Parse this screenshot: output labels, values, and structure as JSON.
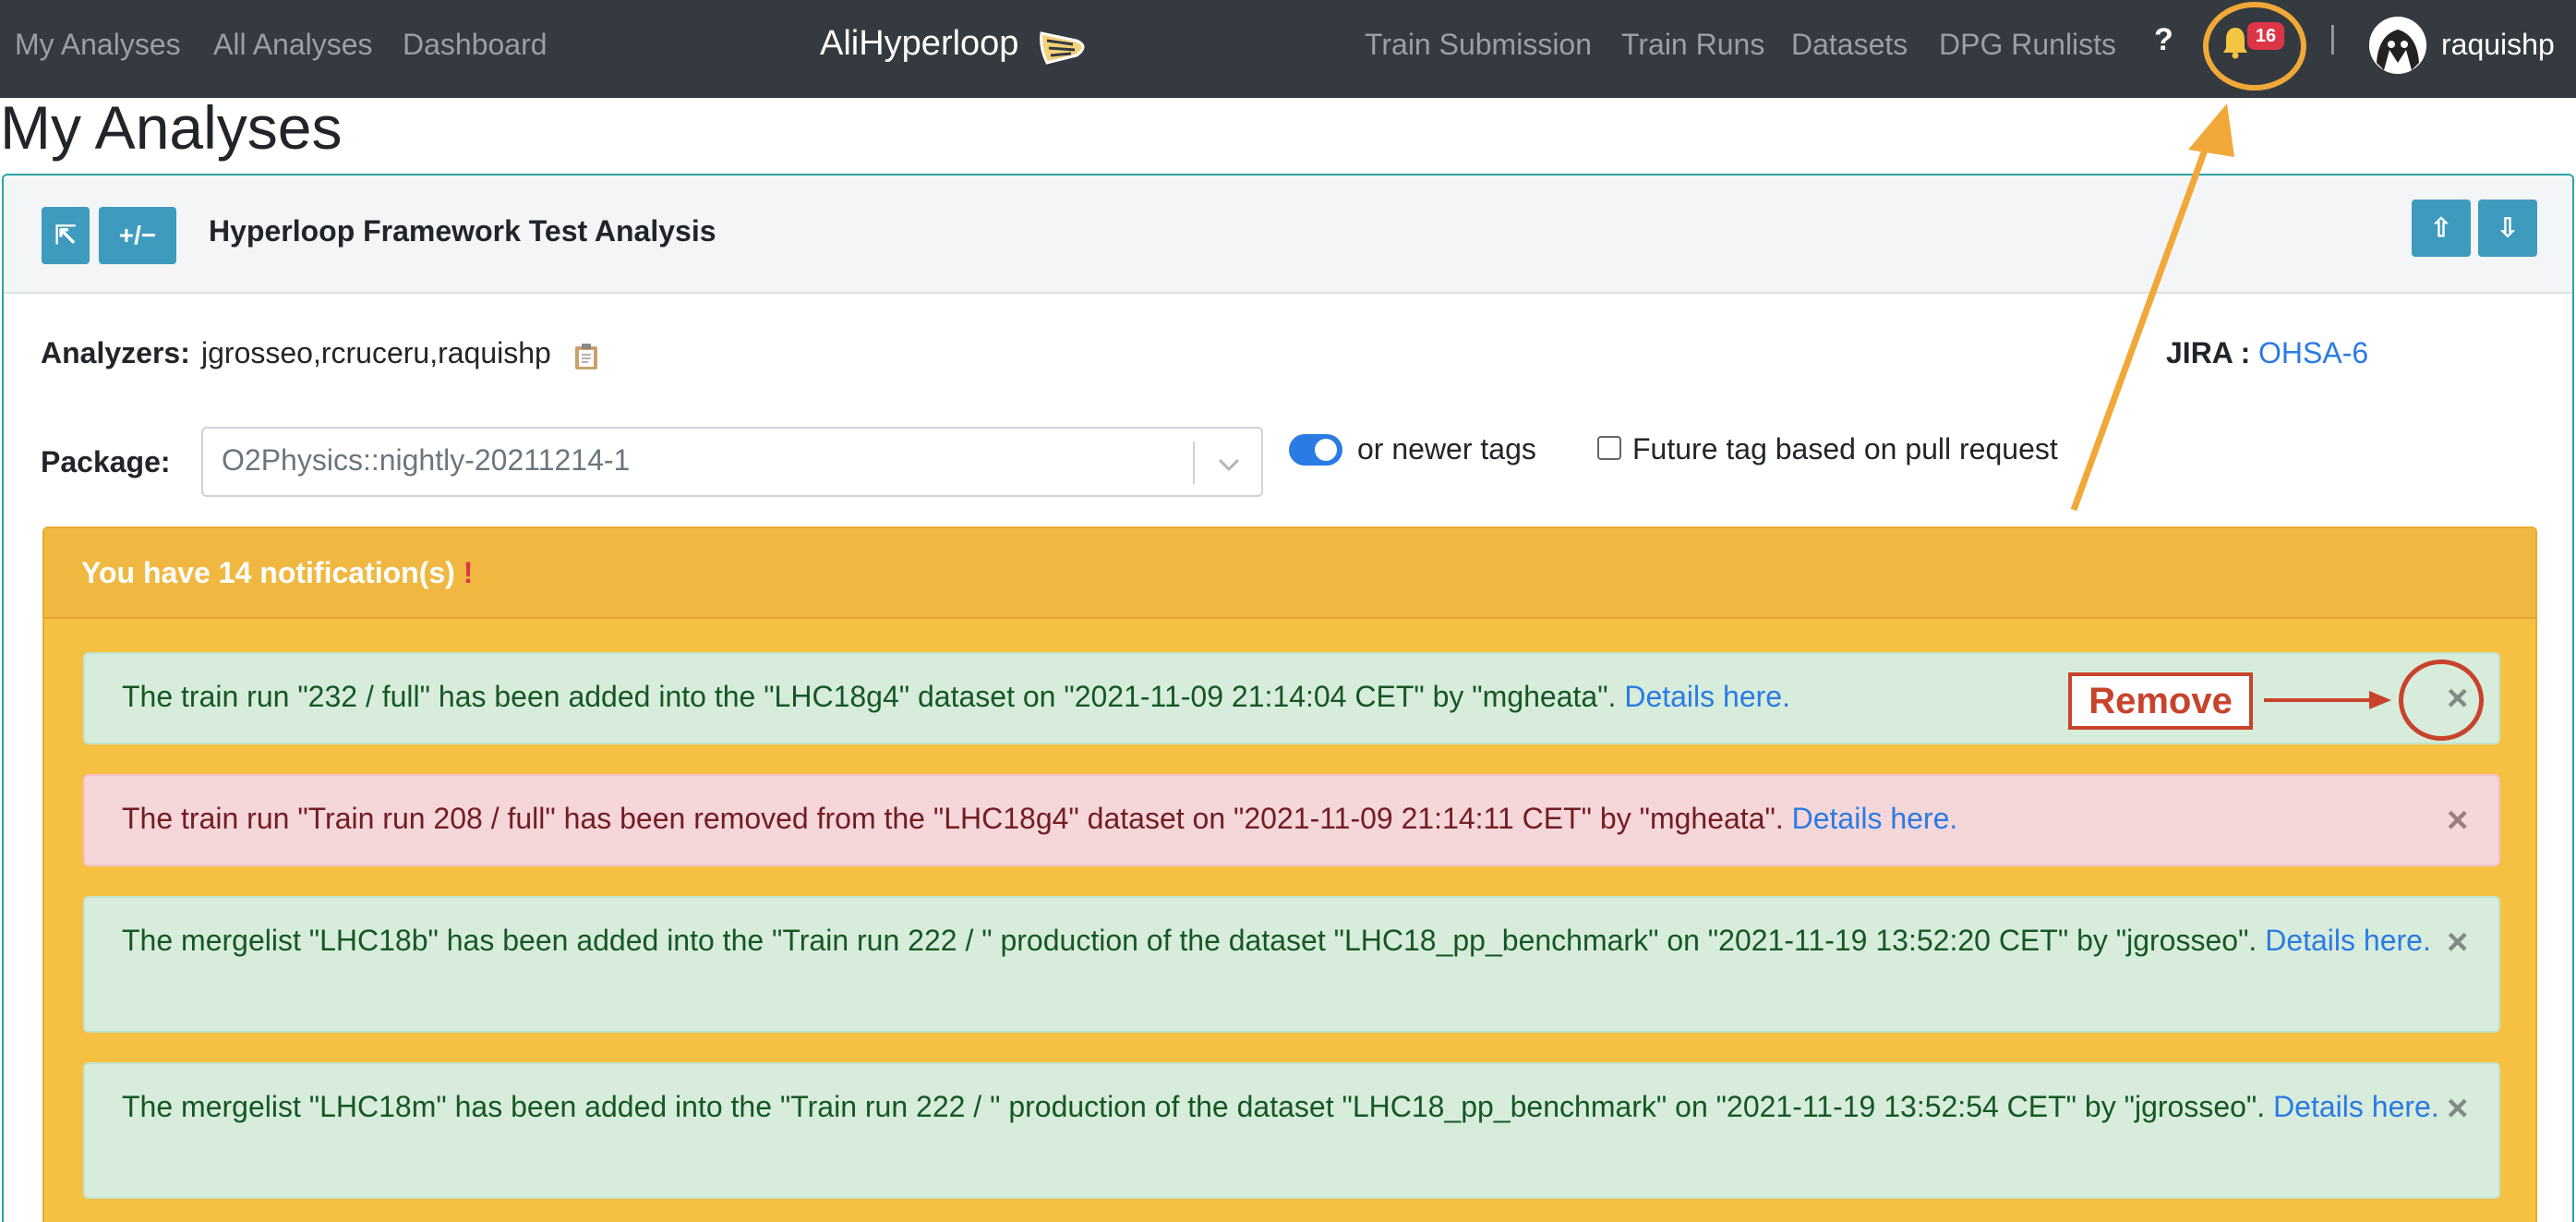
{
  "navbar": {
    "left_links": [
      "My Analyses",
      "All Analyses",
      "Dashboard"
    ],
    "brand": "AliHyperloop",
    "right_links": [
      "Train Submission",
      "Train Runs",
      "Datasets",
      "DPG Runlists"
    ],
    "help": "?",
    "notification_count": "16",
    "divider": "|",
    "username": "raquishp"
  },
  "page": {
    "title": "My Analyses"
  },
  "analysis": {
    "expand_label": "⇱",
    "plusminus_label": "+/−",
    "title": "Hyperloop Framework Test Analysis",
    "move_up_label": "⇧",
    "move_down_label": "⇩",
    "analyzers_label": "Analyzers:",
    "analyzers": "jgrosseo,rcruceru,raquishp",
    "jira_label": "JIRA :",
    "jira_link": "OHSA-6",
    "package_label": "Package:",
    "package_value": "O2Physics::nightly-20211214-1",
    "newer_tags_label": "or newer tags",
    "future_tag_label": "Future tag based on pull request"
  },
  "notifications": {
    "header": "You have 14 notification(s)",
    "header_mark": "!",
    "details_link": "Details here.",
    "items": [
      {
        "type": "success",
        "text": "The train run \"232 / full\" has been added into the \"LHC18g4\" dataset on \"2021-11-09 21:14:04 CET\" by \"mgheata\"."
      },
      {
        "type": "danger",
        "text": "The train run \"Train run 208 / full\" has been removed from the \"LHC18g4\" dataset on \"2021-11-09 21:14:11 CET\" by \"mgheata\"."
      },
      {
        "type": "success",
        "text": "The mergelist \"LHC18b\" has been added into the \"Train run 222 / \" production of the dataset \"LHC18_pp_benchmark\" on \"2021-11-19 13:52:20 CET\" by \"jgrosseo\"."
      },
      {
        "type": "success",
        "text": "The mergelist \"LHC18m\" has been added into the \"Train run 222 / \" production of the dataset \"LHC18_pp_benchmark\" on \"2021-11-19 13:52:54 CET\" by \"jgrosseo\"."
      }
    ],
    "close_glyph": "×"
  },
  "annotation": {
    "remove_label": "Remove"
  },
  "colors": {
    "navbar": "#343a40",
    "accent_teal": "#3e9bbd",
    "warning_panel": "#f6c043",
    "success_bg": "#d7ecdb",
    "danger_bg": "#f5d6d9",
    "link": "#2a7be4",
    "annotation_orange": "#f0a838",
    "annotation_red": "#c8432c"
  }
}
